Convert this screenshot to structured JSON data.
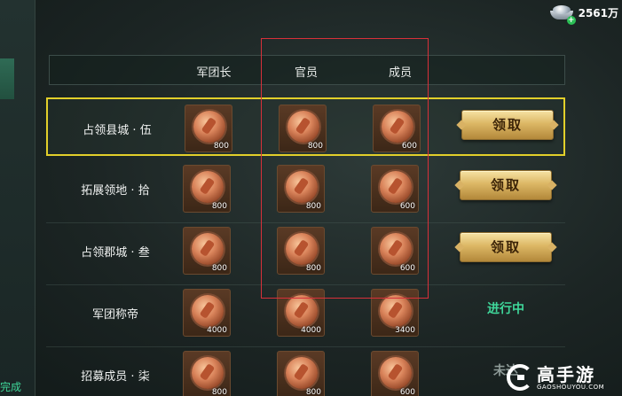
{
  "currency": {
    "icon": "silver-ingot-icon",
    "value": "2561万"
  },
  "left_panel": {
    "bottom_text": "完成"
  },
  "header": {
    "col1": "军团长",
    "col2": "官员",
    "col3": "成员"
  },
  "rows": [
    {
      "label": "占领县城 · 伍",
      "rewards": [
        "800",
        "800",
        "600"
      ],
      "action": "领取",
      "state": "claim",
      "highlighted": true
    },
    {
      "label": "拓展领地 · 拾",
      "rewards": [
        "800",
        "800",
        "600"
      ],
      "action": "领取",
      "state": "claim",
      "highlighted": false
    },
    {
      "label": "占领郡城 · 叁",
      "rewards": [
        "800",
        "800",
        "600"
      ],
      "action": "领取",
      "state": "claim",
      "highlighted": false
    },
    {
      "label": "军团称帝",
      "rewards": [
        "4000",
        "4000",
        "3400"
      ],
      "action": "进行中",
      "state": "in-progress",
      "highlighted": false
    },
    {
      "label": "招募成员 · 柒",
      "rewards": [
        "800",
        "800",
        "600"
      ],
      "action": "未达",
      "state": "not-reached",
      "highlighted": false
    }
  ],
  "colors": {
    "highlight_border": "#e2cf2a",
    "annotation_box": "#d8303a",
    "in_progress": "#3fd79a",
    "not_reached": "#8e9b98"
  },
  "watermark": {
    "title": "高手游",
    "subtitle": "GAOSHOUYOU.COM"
  }
}
